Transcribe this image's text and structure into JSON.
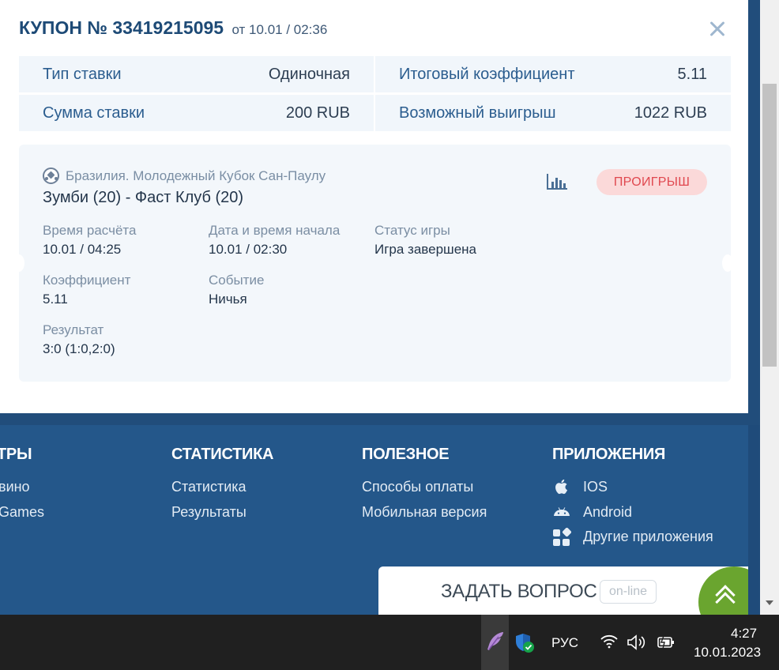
{
  "coupon": {
    "title": "КУПОН № 33419215095",
    "subtitle": "от 10.01 / 02:36",
    "summary": [
      {
        "label": "Тип ставки",
        "value": "Одиночная"
      },
      {
        "label": "Итоговый коэффициент",
        "value": "5.11"
      },
      {
        "label": "Сумма ставки",
        "value": "200 RUB"
      },
      {
        "label": "Возможный выигрыш",
        "value": "1022 RUB"
      }
    ],
    "event": {
      "league": "Бразилия. Молодежный Кубок Сан-Паулу",
      "match": "Зумби (20) - Фаст Клуб (20)",
      "status_badge": "ПРОИГРЫШ",
      "fields": [
        {
          "label": "Время расчёта",
          "value": "10.01 / 04:25"
        },
        {
          "label": "Дата и время начала",
          "value": "10.01 / 02:30"
        },
        {
          "label": "Статус игры",
          "value": "Игра завершена"
        },
        {
          "label": "Коэффициент",
          "value": "5.11"
        },
        {
          "label": "Событие",
          "value": "Ничья"
        },
        {
          "label": "Результат",
          "value": "3:0 (1:0,2:0)"
        }
      ]
    }
  },
  "footer": {
    "columns": [
      {
        "title": "ТРЫ",
        "links": [
          "вино",
          "Games"
        ]
      },
      {
        "title": "СТАТИСТИКА",
        "links": [
          "Статистика",
          "Результаты"
        ]
      },
      {
        "title": "ПОЛЕЗНОЕ",
        "links": [
          "Способы оплаты",
          "Мобильная версия"
        ]
      },
      {
        "title": "ПРИЛОЖЕНИЯ",
        "links": [
          "IOS",
          "Android",
          "Другие приложения"
        ]
      }
    ]
  },
  "ask_widget": {
    "label": "ЗАДАТЬ ВОПРОС",
    "online": "on-line"
  },
  "taskbar": {
    "language": "РУС",
    "time": "4:27",
    "date": "10.01.2023"
  },
  "icons": [
    "close-icon",
    "soccer-ball-icon",
    "stats-chart-icon",
    "apple-icon",
    "android-icon",
    "apps-grid-icon",
    "scroll-up-icon",
    "feather-icon",
    "shield-icon",
    "wifi-icon",
    "speaker-icon",
    "battery-icon"
  ],
  "colors": {
    "title": "#1d4a76",
    "badge_bg": "#fbd9d9",
    "badge_text": "#e0484f",
    "footer_bg": "#24578a",
    "ask_accent": "#6aa52f"
  }
}
